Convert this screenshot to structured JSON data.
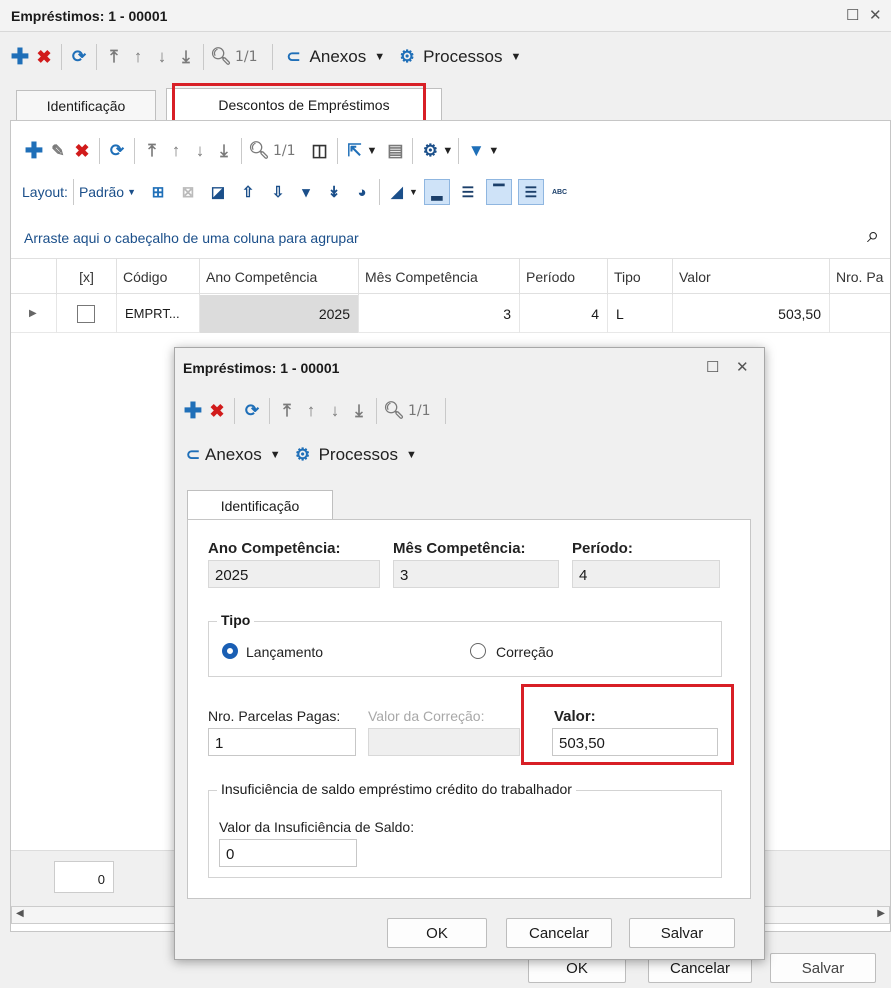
{
  "main": {
    "title": "Empréstimos: 1 - 00001",
    "pager": "1/1",
    "anexos": "Anexos",
    "processos": "Processos",
    "tabs": [
      "Identificação",
      "Descontos de Empréstimos"
    ],
    "sub_pager": "1/1",
    "layout_label": "Layout:",
    "layout_value": "Padrão",
    "abc": "ABC",
    "group_hint": "Arraste aqui o cabeçalho de uma coluna para agrupar",
    "columns": [
      "[x]",
      "Código",
      "Ano Competência",
      "Mês Competência",
      "Período",
      "Tipo",
      "Valor",
      "Nro. Pa"
    ],
    "row": {
      "codigo": "EMPRT...",
      "ano": "2025",
      "mes": "3",
      "periodo": "4",
      "tipo": "L",
      "valor": "503,50"
    },
    "footer_count": "0",
    "ok": "OK",
    "cancelar": "Cancelar",
    "salvar": "Salvar"
  },
  "dialog": {
    "title": "Empréstimos: 1 - 00001",
    "pager": "1/1",
    "anexos": "Anexos",
    "processos": "Processos",
    "tab": "Identificação",
    "ano_label": "Ano Competência:",
    "ano_value": "2025",
    "mes_label": "Mês Competência:",
    "mes_value": "3",
    "periodo_label": "Período:",
    "periodo_value": "4",
    "tipo_label": "Tipo",
    "lancamento": "Lançamento",
    "correcao": "Correção",
    "parcelas_label": "Nro. Parcelas Pagas:",
    "parcelas_value": "1",
    "valor_correcao_label": "Valor da Correção:",
    "valor_label": "Valor:",
    "valor_value": "503,50",
    "insuf_group": "Insuficiência de saldo empréstimo crédito do trabalhador",
    "insuf_label": "Valor da Insuficiência de Saldo:",
    "insuf_value": "0",
    "ok": "OK",
    "cancelar": "Cancelar",
    "salvar": "Salvar"
  },
  "colors": {
    "accent": "#1f6fb8",
    "delete": "#d11b1b",
    "highlight": "#d81f26"
  }
}
